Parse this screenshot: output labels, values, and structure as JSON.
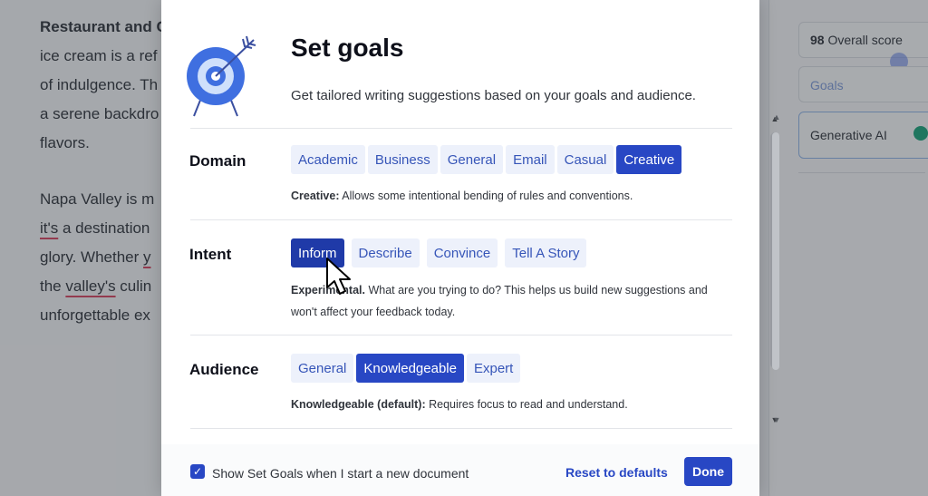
{
  "editor": {
    "line1_bold": "Restaurant and C",
    "line2": "ice cream is a ref",
    "line3": "of indulgence. Th",
    "line4": "a serene backdro",
    "line5": "flavors.",
    "line6": "Napa Valley is m",
    "line7_pre": "it's",
    "line7_post": " a destination",
    "line8_pre": "glory. Whether ",
    "line8_y": "y",
    "line9_pre": "the ",
    "line9_ul": "valley's",
    "line9_post": " culin",
    "line10": "unforgettable ex"
  },
  "side_panel": {
    "score_value": "98",
    "score_label": " Overall score",
    "goals_label": "Goals",
    "generative_ai_label": "Generative AI"
  },
  "modal": {
    "title": "Set goals",
    "subtitle": "Get tailored writing suggestions based on your goals and audience.",
    "domain": {
      "label": "Domain",
      "options": [
        "Academic",
        "Business",
        "General",
        "Email",
        "Casual",
        "Creative"
      ],
      "selected": "Creative",
      "desc_bold": "Creative:",
      "desc": " Allows some intentional bending of rules and conventions."
    },
    "intent": {
      "label": "Intent",
      "options": [
        "Inform",
        "Describe",
        "Convince",
        "Tell A Story"
      ],
      "selected": "Inform",
      "desc_bold": "Experimental.",
      "desc": " What are you trying to do? This helps us build new suggestions and won't affect your feedback today."
    },
    "audience": {
      "label": "Audience",
      "options": [
        "General",
        "Knowledgeable",
        "Expert"
      ],
      "selected": "Knowledgeable",
      "desc_bold": "Knowledgeable (default):",
      "desc": " Requires focus to read and understand."
    },
    "footer": {
      "checkbox_checked": true,
      "checkbox_pre": "Show ",
      "checkbox_mid": "Set Goals",
      "checkbox_post": " when I start a new document",
      "reset_label": "Reset to defaults",
      "done_label": "Done"
    }
  },
  "colors": {
    "primary": "#2847c4",
    "chip_bg": "#edf1fb",
    "chip_text": "#3655b8",
    "illustration_blue": "#3f6fe0",
    "illustration_light": "#cfe0fb"
  }
}
